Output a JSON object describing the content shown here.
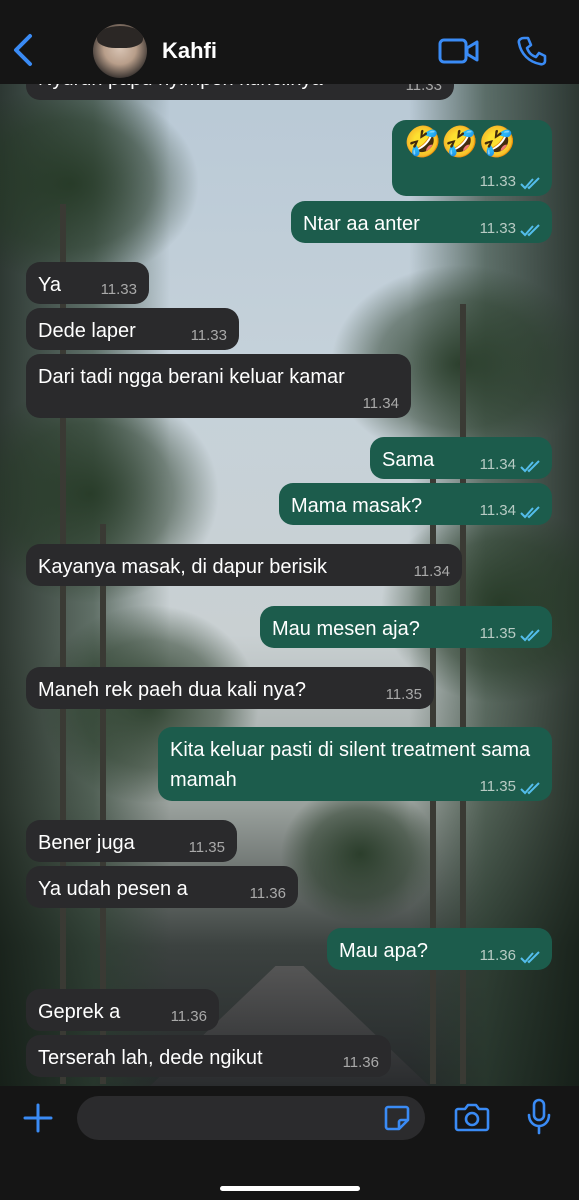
{
  "header": {
    "contact_name": "Kahfi",
    "back_icon": "chevron-left-icon",
    "video_icon": "video-camera-icon",
    "call_icon": "phone-icon",
    "accent": "#3a8bf5"
  },
  "messages": [
    {
      "dir": "in",
      "text": "Nyuruh papu nyimpen kunciinya",
      "time": "11.33"
    },
    {
      "dir": "out",
      "text": "🤣🤣🤣",
      "time": "11.33",
      "read": true
    },
    {
      "dir": "out",
      "text": "Ntar aa anter",
      "time": "11.33",
      "read": true
    },
    {
      "dir": "in",
      "text": "Ya",
      "time": "11.33"
    },
    {
      "dir": "in",
      "text": "Dede laper",
      "time": "11.33"
    },
    {
      "dir": "in",
      "text": "Dari tadi ngga berani keluar kamar",
      "time": "11.34"
    },
    {
      "dir": "out",
      "text": "Sama",
      "time": "11.34",
      "read": true
    },
    {
      "dir": "out",
      "text": "Mama masak?",
      "time": "11.34",
      "read": true
    },
    {
      "dir": "in",
      "text": "Kayanya masak, di dapur berisik",
      "time": "11.34"
    },
    {
      "dir": "out",
      "text": "Mau mesen aja?",
      "time": "11.35",
      "read": true
    },
    {
      "dir": "in",
      "text": "Maneh rek paeh dua kali nya?",
      "time": "11.35"
    },
    {
      "dir": "out",
      "text": "Kita keluar pasti di silent treatment sama mamah",
      "time": "11.35",
      "read": true
    },
    {
      "dir": "in",
      "text": "Bener juga",
      "time": "11.35"
    },
    {
      "dir": "in",
      "text": "Ya udah pesen a",
      "time": "11.36"
    },
    {
      "dir": "out",
      "text": "Mau apa?",
      "time": "11.36",
      "read": true
    },
    {
      "dir": "in",
      "text": "Geprek a",
      "time": "11.36"
    },
    {
      "dir": "in",
      "text": "Terserah lah, dede ngikut",
      "time": "11.36"
    }
  ],
  "composer": {
    "plus_icon": "plus-icon",
    "sticker_icon": "sticker-icon",
    "camera_icon": "camera-icon",
    "mic_icon": "microphone-icon",
    "value": ""
  },
  "colors": {
    "incoming_bubble": "#2a2a2c",
    "outgoing_bubble": "#1c5c4c",
    "read_ticks": "#53bdeb"
  }
}
